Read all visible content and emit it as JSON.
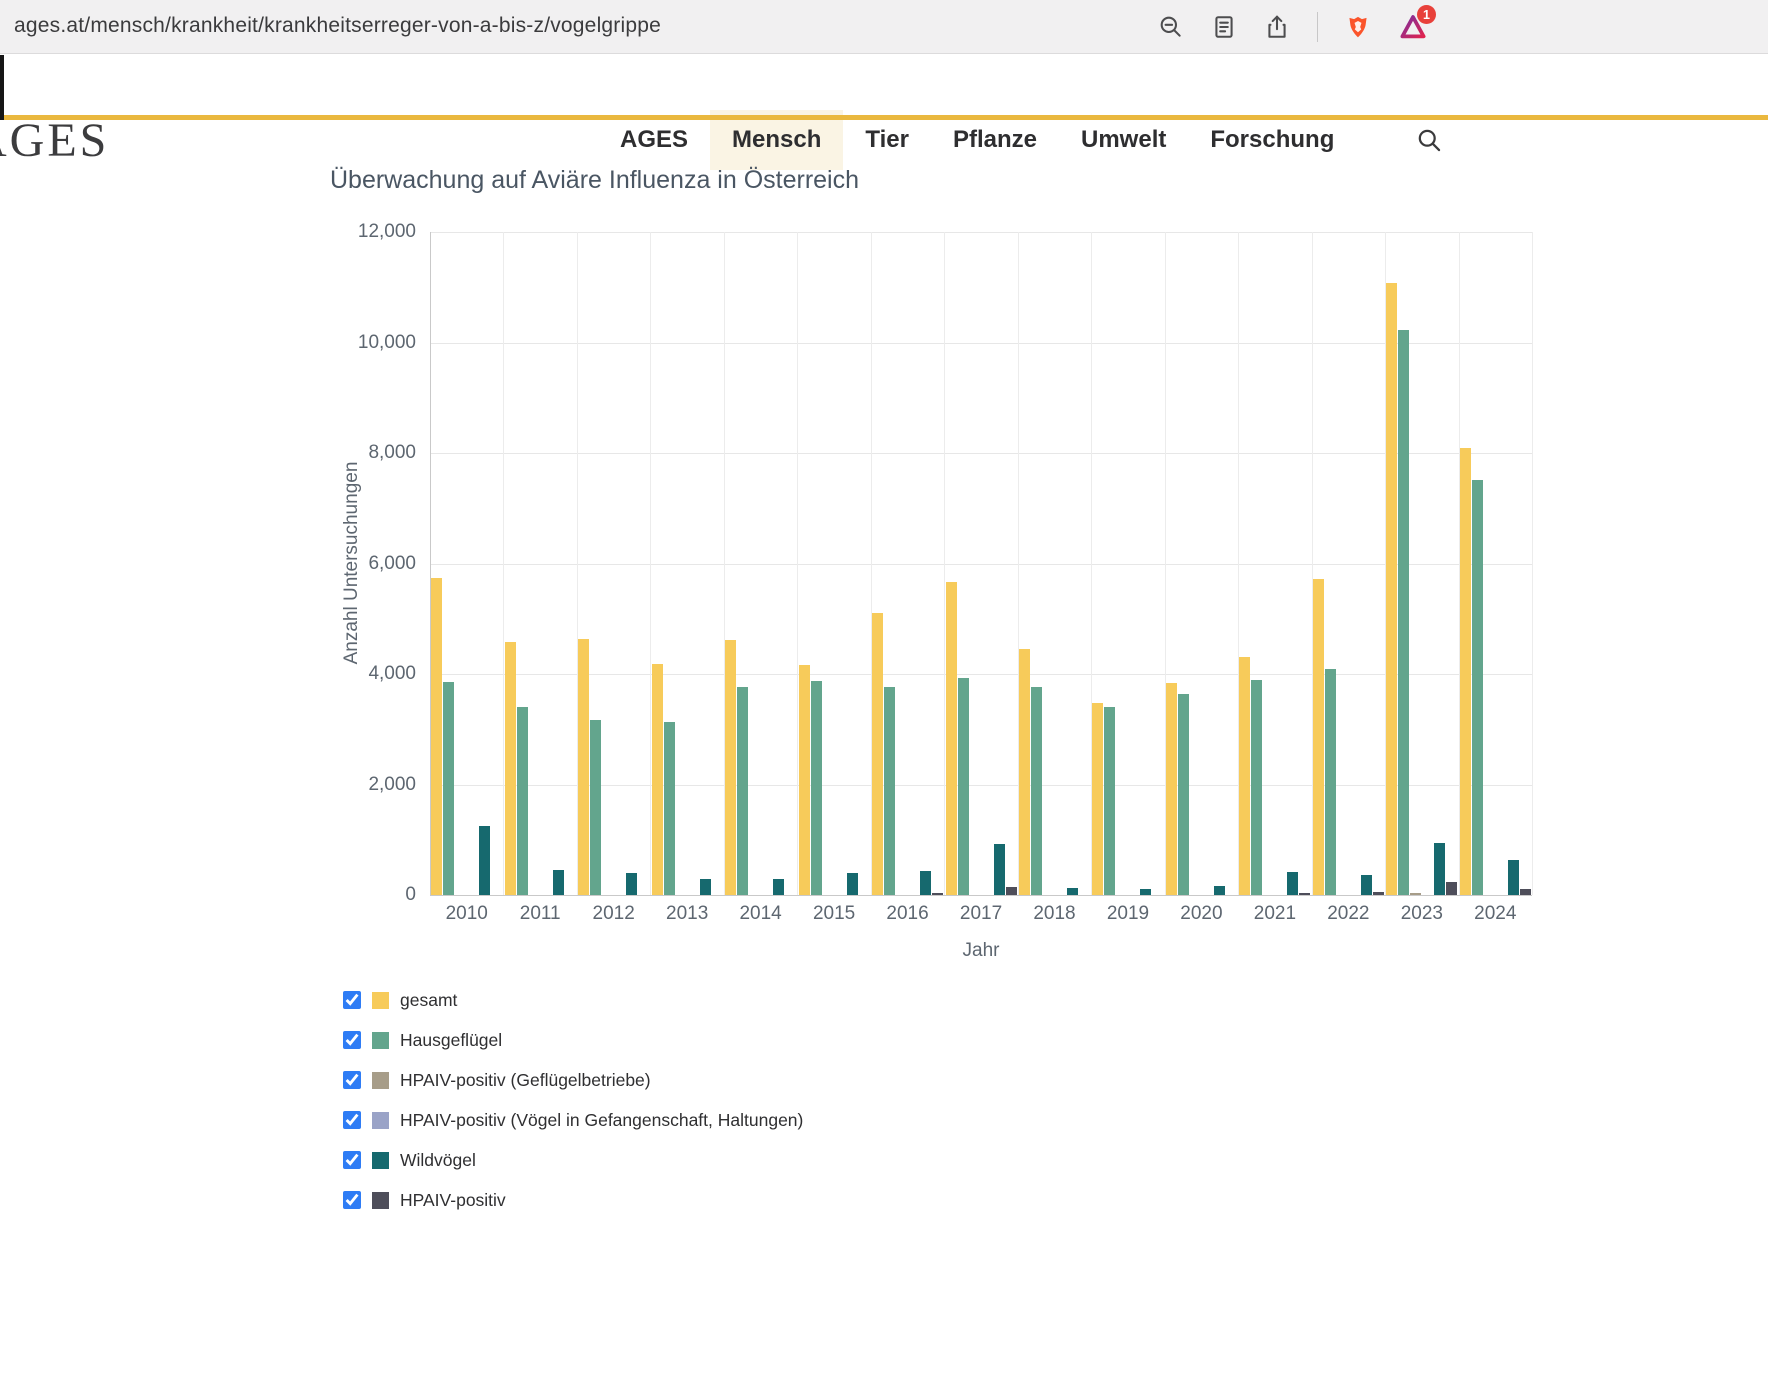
{
  "browser": {
    "url": "ages.at/mensch/krankheit/krankheitserreger-von-a-bis-z/vogelgrippe",
    "badge_count": "1"
  },
  "header": {
    "logo": "AGES",
    "nav": [
      {
        "label": "AGES",
        "active": false
      },
      {
        "label": "Mensch",
        "active": true
      },
      {
        "label": "Tier",
        "active": false
      },
      {
        "label": "Pflanze",
        "active": false
      },
      {
        "label": "Umwelt",
        "active": false
      },
      {
        "label": "Forschung",
        "active": false
      }
    ],
    "accent_color": "#EAB83E"
  },
  "chart_data": {
    "type": "bar",
    "title": "Überwachung auf Aviäre Influenza in Österreich",
    "xlabel": "Jahr",
    "ylabel": "Anzahl Untersuchungen",
    "ylim": [
      0,
      12000
    ],
    "yticks": [
      0,
      2000,
      4000,
      6000,
      8000,
      10000,
      12000
    ],
    "grid": true,
    "legend_position": "bottom-left",
    "categories": [
      "2010",
      "2011",
      "2012",
      "2013",
      "2014",
      "2015",
      "2016",
      "2017",
      "2018",
      "2019",
      "2020",
      "2021",
      "2022",
      "2023",
      "2024"
    ],
    "series": [
      {
        "name": "gesamt",
        "color": "#F7CB5A",
        "values": [
          5730,
          4580,
          4640,
          4180,
          4620,
          4160,
          5110,
          5670,
          4450,
          3470,
          3840,
          4300,
          5720,
          11080,
          8090
        ]
      },
      {
        "name": "Hausgeflügel",
        "color": "#63A58D",
        "values": [
          3850,
          3400,
          3160,
          3140,
          3760,
          3870,
          3760,
          3930,
          3760,
          3400,
          3640,
          3890,
          4090,
          10230,
          7510
        ]
      },
      {
        "name": "HPAIV-positiv (Geflügelbetriebe)",
        "color": "#A79D89",
        "values": [
          0,
          0,
          0,
          0,
          0,
          0,
          0,
          0,
          0,
          0,
          0,
          0,
          0,
          40,
          0
        ]
      },
      {
        "name": "HPAIV-positiv (Vögel in Gefangenschaft, Haltungen)",
        "color": "#9AA3C7",
        "values": [
          0,
          0,
          0,
          0,
          0,
          0,
          0,
          0,
          0,
          0,
          0,
          0,
          0,
          0,
          0
        ]
      },
      {
        "name": "Wildvögel",
        "color": "#16696E",
        "values": [
          1250,
          450,
          390,
          290,
          290,
          390,
          430,
          930,
          130,
          100,
          170,
          420,
          360,
          950,
          630
        ]
      },
      {
        "name": "HPAIV-positiv",
        "color": "#4E4E5A",
        "values": [
          0,
          0,
          0,
          0,
          0,
          0,
          30,
          150,
          0,
          0,
          0,
          20,
          50,
          230,
          110
        ]
      }
    ]
  }
}
